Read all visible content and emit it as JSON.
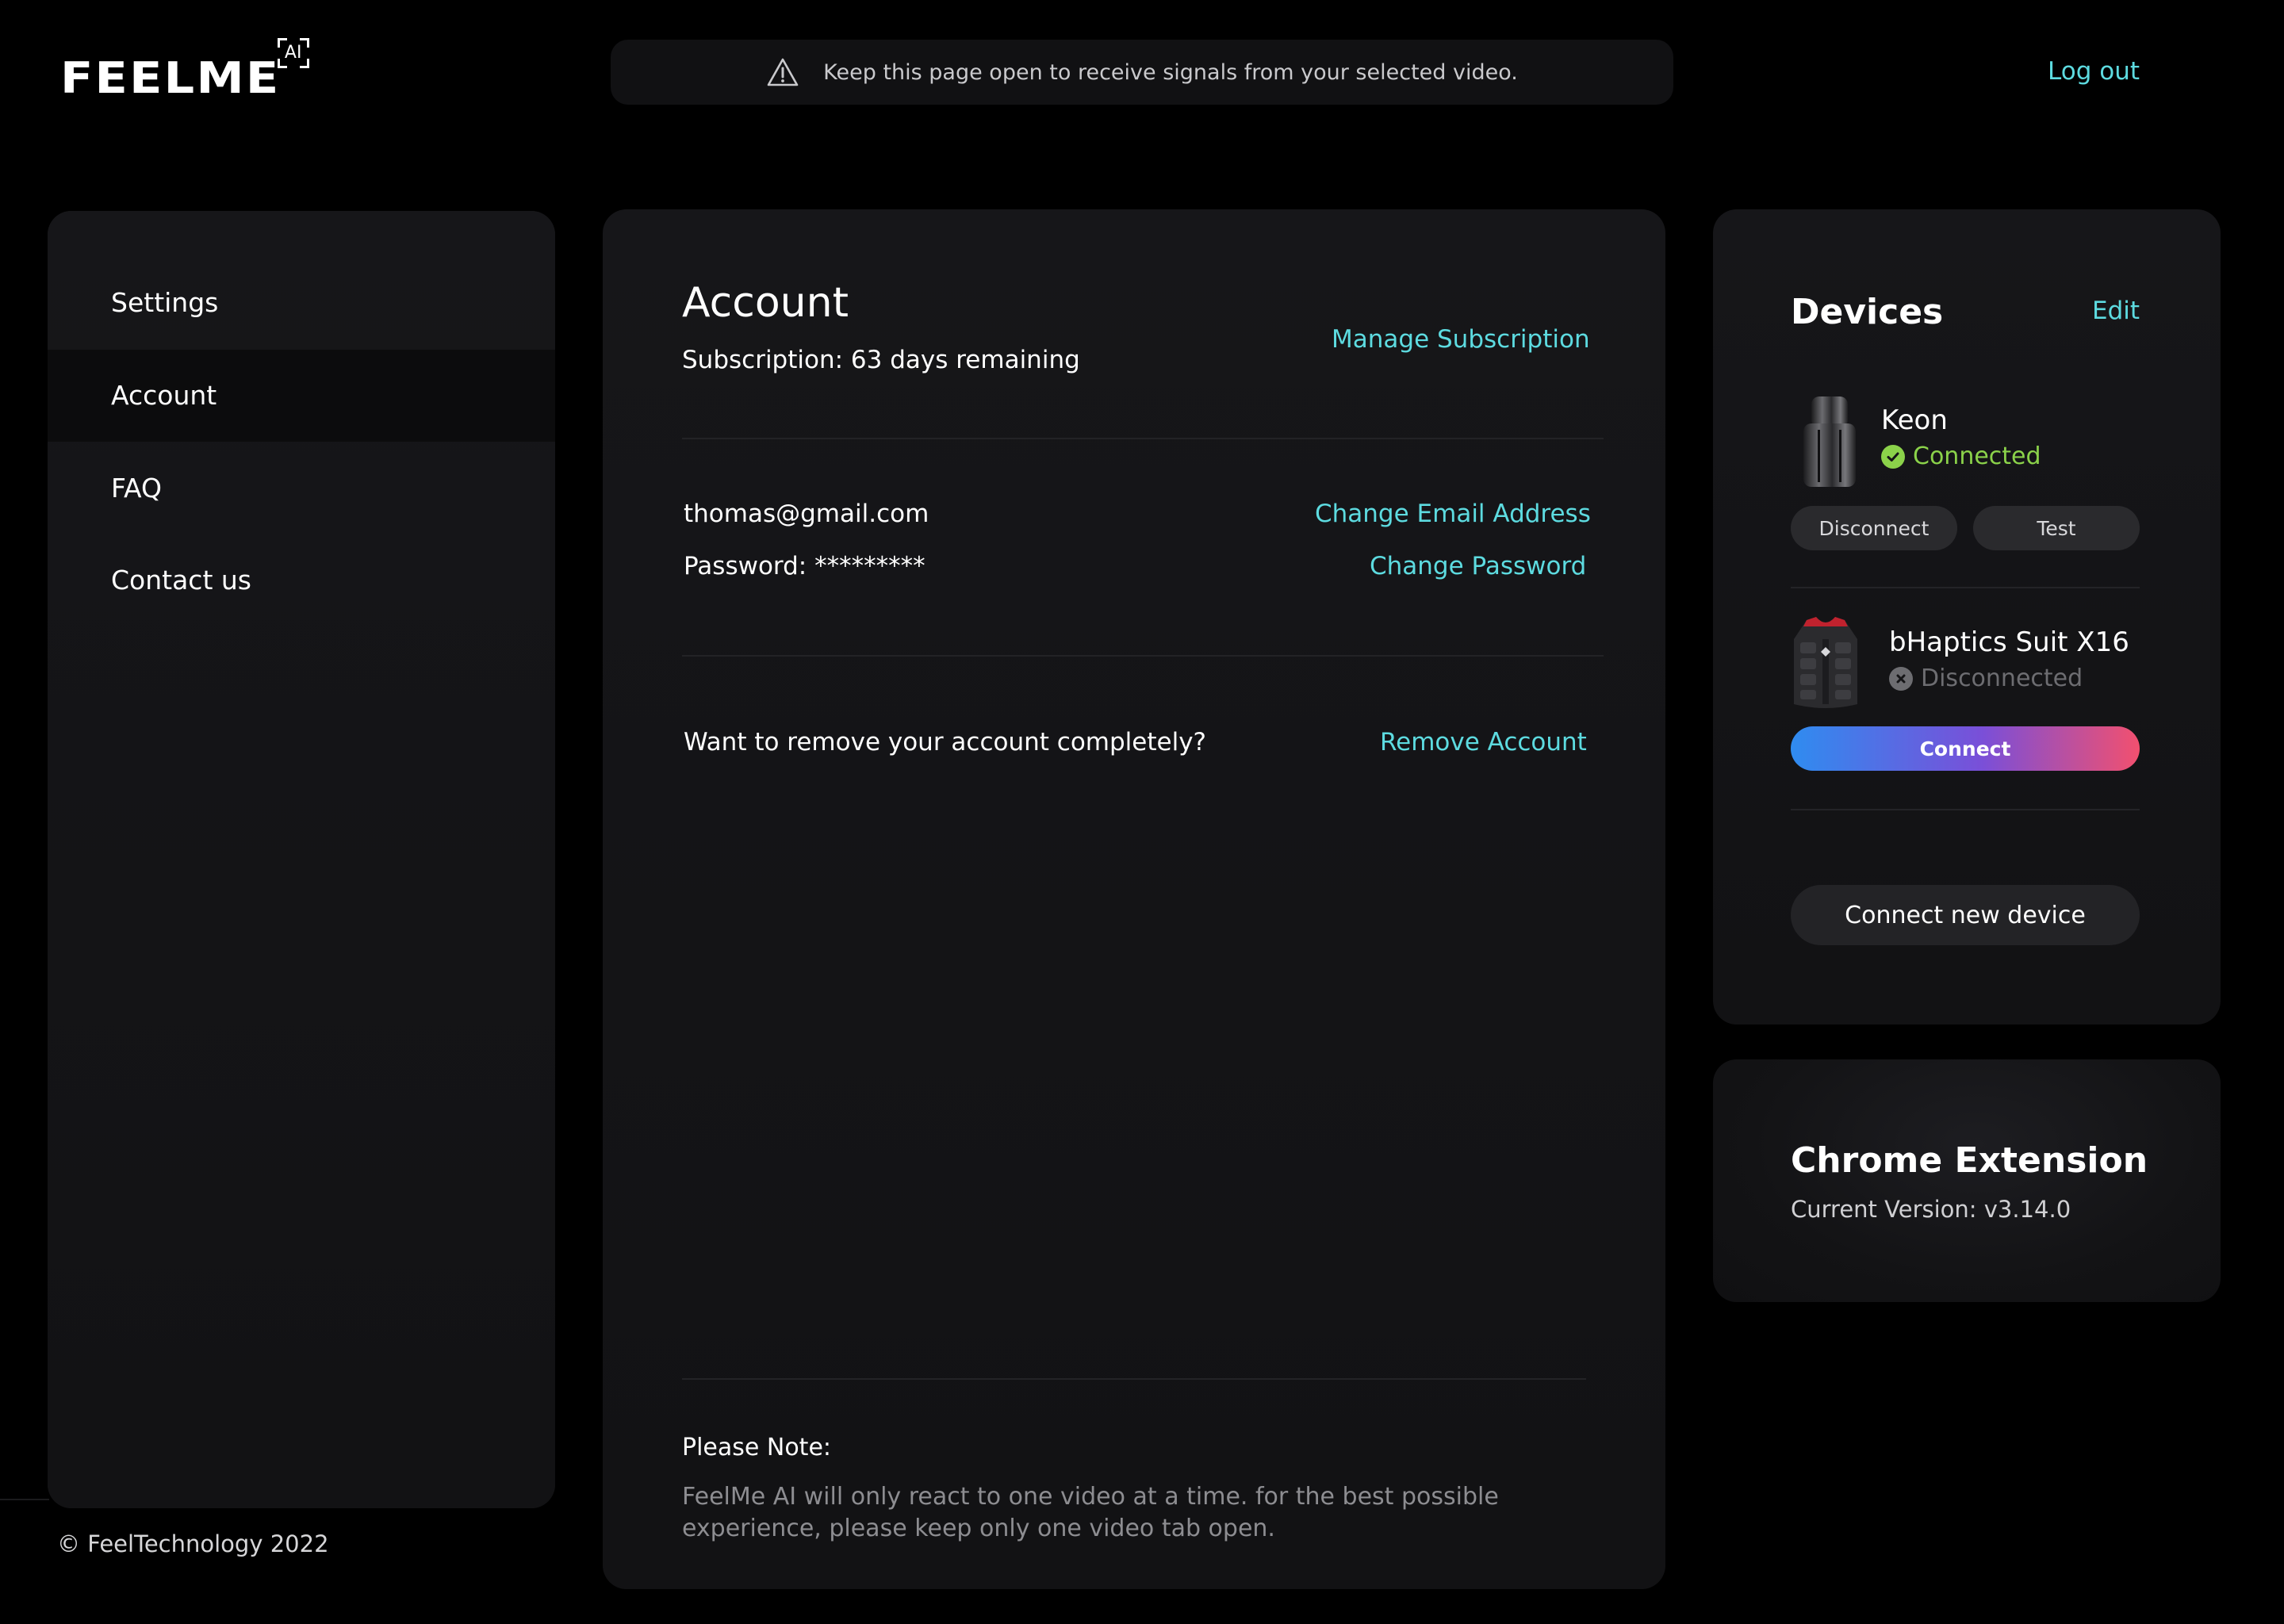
{
  "brand": {
    "logo_text": "FEELME",
    "logo_badge": "AI"
  },
  "header": {
    "notice": "Keep this page open to receive signals from your selected video.",
    "notice_icon": "warning-triangle-icon",
    "logout": "Log out"
  },
  "sidebar": {
    "items": [
      {
        "label": "Settings",
        "active": false
      },
      {
        "label": "Account",
        "active": true
      },
      {
        "label": "FAQ",
        "active": false
      },
      {
        "label": "Contact us",
        "active": false
      }
    ]
  },
  "footer": {
    "copyright": "© FeelTechnology 2022"
  },
  "account": {
    "title": "Account",
    "subscription": "Subscription: 63 days remaining",
    "manage_subscription": "Manage Subscription",
    "email": "thomas@gmail.com",
    "change_email": "Change Email Address",
    "password": "Password: *********",
    "change_password": "Change Password",
    "remove_prompt": "Want to remove your account completely?",
    "remove_account": "Remove Account",
    "note_title": "Please Note:",
    "note_body": "FeelMe AI will only react to one video at a time. for the best possible experience, please keep only one video tab open."
  },
  "devices": {
    "title": "Devices",
    "edit": "Edit",
    "list": [
      {
        "name": "Keon",
        "status": "Connected",
        "status_icon": "check-circle-icon",
        "actions": [
          "Disconnect",
          "Test"
        ]
      },
      {
        "name": "bHaptics Suit X16",
        "status": "Disconnected",
        "status_icon": "x-circle-icon",
        "action": "Connect"
      }
    ],
    "connect_new": "Connect new device"
  },
  "extension": {
    "title": "Chrome Extension",
    "version": "Current Version:  v3.14.0"
  },
  "colors": {
    "accent": "#5ddbe0",
    "connected": "#8bd24a",
    "background": "#000000",
    "card": "#151517",
    "gradient_start": "#2f8cf0",
    "gradient_end": "#f2506f"
  }
}
